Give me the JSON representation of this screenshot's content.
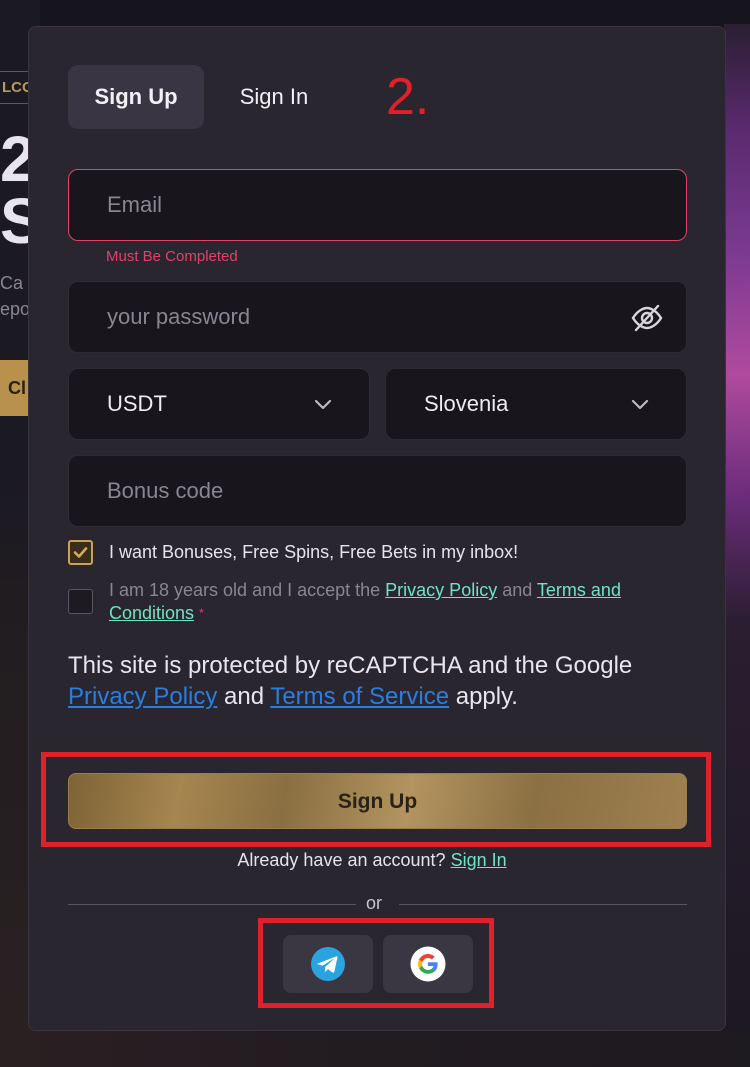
{
  "background": {
    "welcome_tag": "LCO",
    "big_text": "2\nS",
    "sub_text": "Ca\nepo",
    "cta_label": "Cl"
  },
  "tabs": [
    {
      "label": "Sign Up",
      "active": true
    },
    {
      "label": "Sign In",
      "active": false
    }
  ],
  "annotation": {
    "step": "2.",
    "color": "#e0202a"
  },
  "form": {
    "email_placeholder": "Email",
    "email_error": "Must Be Completed",
    "password_placeholder": "your password",
    "currency": "USDT",
    "country": "Slovenia",
    "bonus_placeholder": "Bonus code",
    "checkbox_bonuses": {
      "label": "I want Bonuses, Free Spins, Free Bets in my inbox!",
      "checked": true
    },
    "checkbox_terms": {
      "prefix": "I am 18 years old and I accept the ",
      "privacy_link": "Privacy Policy",
      "middle": " and ",
      "terms_link": "Terms and Conditions",
      "required_mark": "*",
      "checked": false
    },
    "recaptcha": {
      "prefix": "This site is protected by reCAPTCHA and the Google ",
      "privacy_link": "Privacy Policy",
      "middle": " and ",
      "terms_link": "Terms of Service",
      "suffix": " apply."
    },
    "submit_label": "Sign Up",
    "already_text": "Already have an account?",
    "signin_link": "Sign In",
    "or_text": "or"
  },
  "social": [
    "telegram-icon",
    "google-icon"
  ],
  "colors": {
    "error": "#e3406a",
    "link_mint": "#6fe3c3",
    "link_blue": "#2a7de1",
    "gold": "#a6864f",
    "modal_bg": "#2a2630"
  }
}
